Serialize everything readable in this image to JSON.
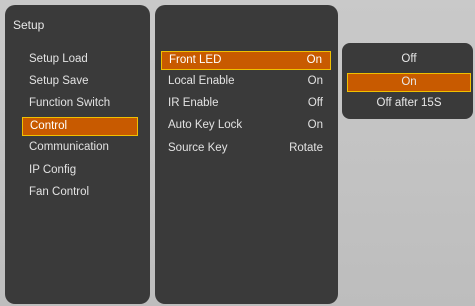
{
  "setup": {
    "title": "Setup",
    "items": [
      {
        "label": "Setup Load"
      },
      {
        "label": "Setup Save"
      },
      {
        "label": "Function Switch"
      },
      {
        "label": "Control"
      },
      {
        "label": "Communication"
      },
      {
        "label": "IP Config"
      },
      {
        "label": "Fan Control"
      }
    ],
    "selected_index": 3
  },
  "control": {
    "items": [
      {
        "label": "Front LED",
        "value": "On"
      },
      {
        "label": "Local Enable",
        "value": "On"
      },
      {
        "label": "IR Enable",
        "value": "Off"
      },
      {
        "label": "Auto Key Lock",
        "value": "On"
      },
      {
        "label": "Source Key",
        "value": "Rotate"
      }
    ],
    "selected_index": 0
  },
  "options": {
    "items": [
      {
        "label": "Off"
      },
      {
        "label": "On"
      },
      {
        "label": "Off after 15S"
      }
    ],
    "selected_index": 1
  },
  "colors": {
    "panel": "#3a3a3a",
    "highlight_fill": "#c85a00",
    "highlight_border": "#f0c000",
    "background": "#c4c4c4"
  }
}
